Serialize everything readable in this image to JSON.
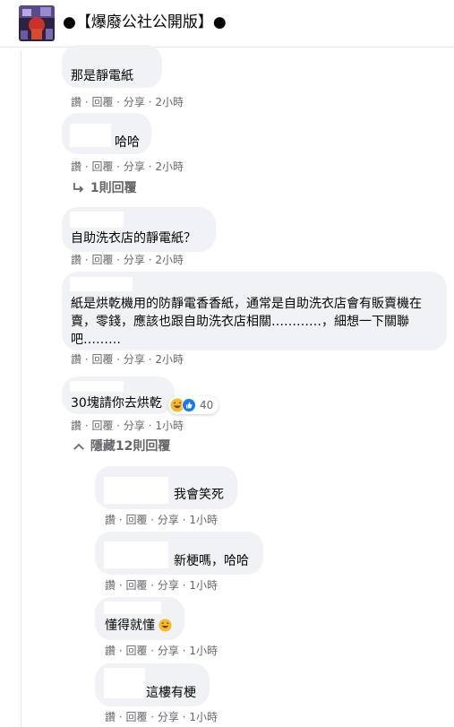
{
  "header": {
    "group_name": "●【爆廢公社公開版】●"
  },
  "comments": [
    {
      "text": "那是靜電紙",
      "actions": "讚 · 回覆 · 分享 · 2小時"
    },
    {
      "text": "哈哈",
      "actions": "讚 · 回覆 · 分享 · 2小時",
      "reply_toggle": "1則回覆"
    },
    {
      "text": "自助洗衣店的靜電紙？",
      "actions": "讚 · 回覆 · 分享 · 2小時"
    },
    {
      "text": "紙是烘乾機用的防靜電香香紙，通常是自助洗衣店會有販賣機在賣，零錢，應該也跟自助洗衣店相關…………，細想一下關聯吧………",
      "actions": "讚 · 回覆 · 分享 · 2小時"
    },
    {
      "text": "30塊請你去烘乾",
      "actions": "讚 · 回覆 · 分享 · 1小時",
      "reaction_count": "40",
      "reply_toggle": "隱藏12則回覆"
    }
  ],
  "replies": [
    {
      "text": "我會笑死",
      "actions": "讚 · 回覆 · 分享 · 1小時"
    },
    {
      "text": "新梗嗎，哈哈",
      "actions": "讚 · 回覆 · 分享 · 1小時"
    },
    {
      "text": "懂得就懂",
      "actions": "讚 · 回覆 · 分享 · 1小時"
    },
    {
      "text": "這樓有梗",
      "actions": "讚 · 回覆 · 分享 · 1小時"
    }
  ],
  "icons": {
    "reply_arrow": "reply-arrow-icon",
    "collapse": "chevron-up-icon",
    "haha": "haha-reaction-icon",
    "like": "like-reaction-icon"
  },
  "colors": {
    "bubble": "#f0f2f5",
    "meta_text": "#65676b",
    "like_blue": "#1877f2",
    "haha_yellow": "#f7b928"
  }
}
